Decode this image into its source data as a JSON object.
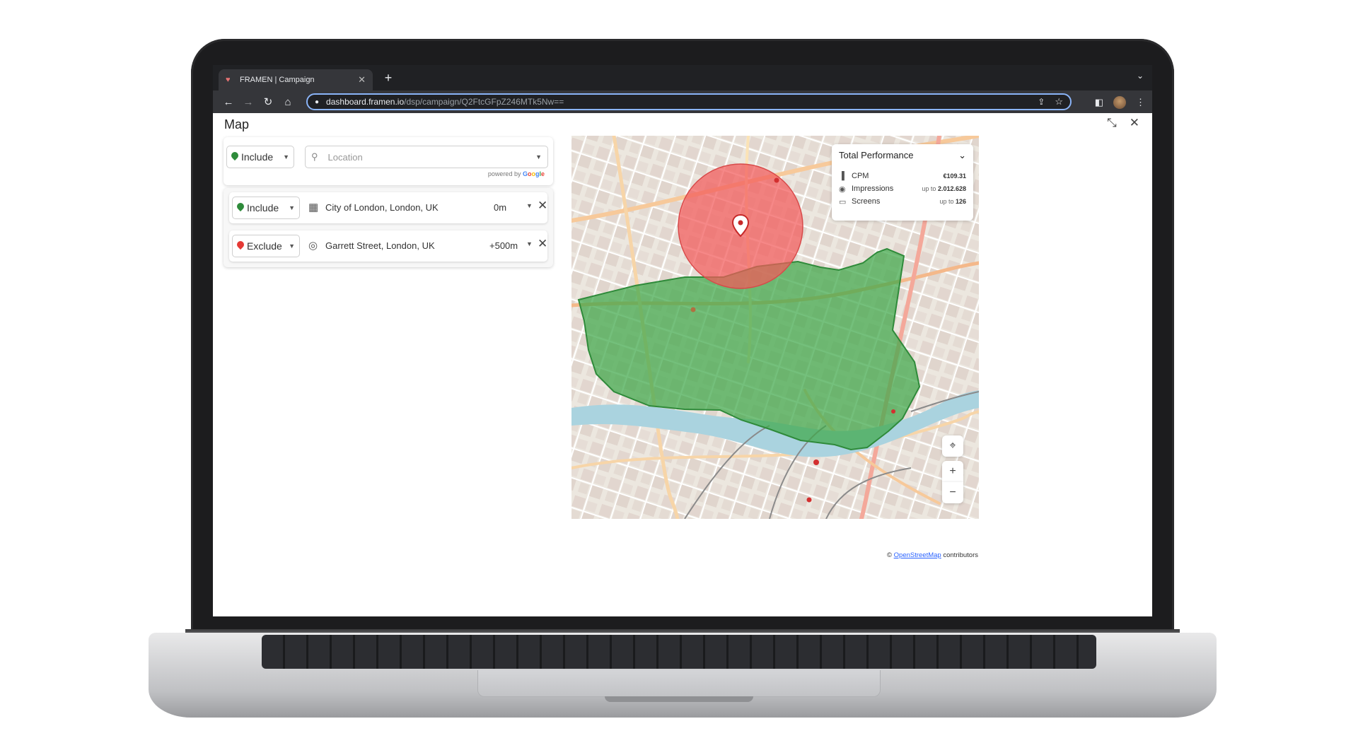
{
  "browser": {
    "tab_title": "FRAMEN | Campaign",
    "tab_close": "✕",
    "new_tab": "+",
    "tab_menu": "⌄",
    "url_host": "dashboard.framen.io",
    "url_path": "/dsp/campaign/Q2FtcGFpZ246MTk5Nw==",
    "nav_back": "←",
    "nav_forward": "→",
    "nav_reload": "↻",
    "nav_home": "⌂",
    "lock": "🔒",
    "share": "⇪",
    "star": "☆",
    "sidepanel": "◧",
    "menu": "⋮"
  },
  "app": {
    "title": "Map",
    "collapse": "⤡",
    "close": "✕"
  },
  "search": {
    "mode_label": "Include",
    "placeholder": "Location",
    "powered_prefix": "powered by ",
    "google": [
      "G",
      "o",
      "o",
      "g",
      "l",
      "e"
    ]
  },
  "rules": [
    {
      "mode": "Include",
      "place": "City of London, London, UK",
      "radius": "0m"
    },
    {
      "mode": "Exclude",
      "place": "Garrett Street, London, UK",
      "radius": "+500m"
    }
  ],
  "performance": {
    "title": "Total Performance",
    "rows": [
      {
        "label": "CPM",
        "prefix": "",
        "value": "€109.31"
      },
      {
        "label": "Impressions",
        "prefix": "up to ",
        "value": "2.012.628"
      },
      {
        "label": "Screens",
        "prefix": "up to ",
        "value": "126"
      }
    ]
  },
  "map_controls": {
    "locate": "⌖",
    "zoom_in": "+",
    "zoom_out": "−"
  },
  "attribution": {
    "prefix": "© ",
    "link": "OpenStreetMap",
    "suffix": " contributors"
  },
  "colors": {
    "include_area": "#3ea84a",
    "exclude_area": "#f25a5a",
    "river": "#aad3df",
    "accent_url": "#8ab4f8"
  }
}
